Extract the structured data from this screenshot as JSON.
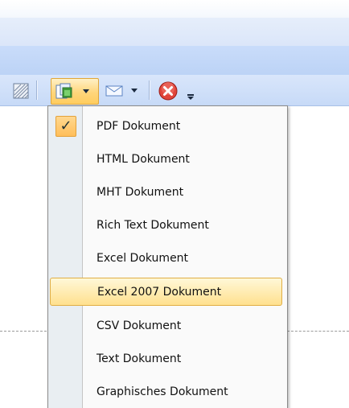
{
  "toolbar": {
    "icons": [
      "hatch-icon",
      "export-icon",
      "mail-icon",
      "close-icon",
      "overflow-icon"
    ],
    "active_button": "export",
    "accent_hover": "#ffd57b"
  },
  "export_menu": {
    "checked_index": 0,
    "highlighted_index": 5,
    "items": [
      {
        "label": "PDF Dokument"
      },
      {
        "label": "HTML Dokument"
      },
      {
        "label": "MHT Dokument"
      },
      {
        "label": "Rich Text Dokument"
      },
      {
        "label": "Excel Dokument"
      },
      {
        "label": "Excel 2007 Dokument"
      },
      {
        "label": "CSV Dokument"
      },
      {
        "label": "Text Dokument"
      },
      {
        "label": "Graphisches Dokument"
      }
    ],
    "check_glyph": "✓"
  }
}
